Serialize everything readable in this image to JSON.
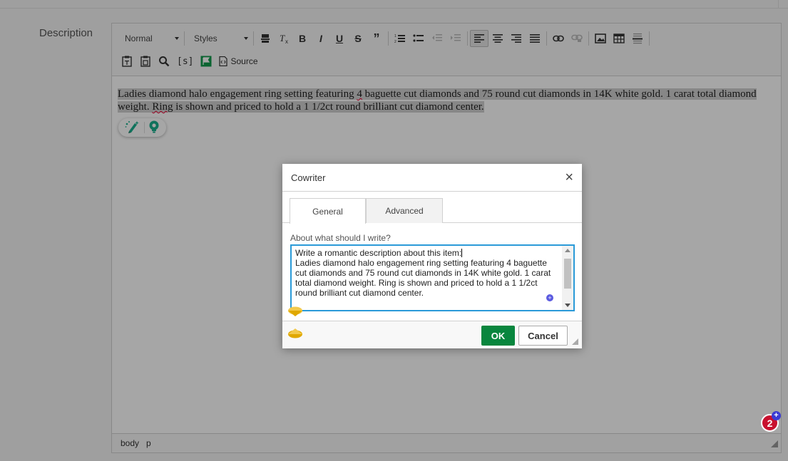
{
  "form": {
    "description_label": "Description"
  },
  "toolbar": {
    "format_combo": "Normal",
    "styles_combo": "Styles",
    "source_label": "Source",
    "variables_label": "[s]"
  },
  "editor": {
    "content_part1": "Ladies diamond halo engagement ring setting featuring ",
    "content_misspelled1": "4",
    "content_part2": " baguette cut diamonds and 75 round cut diamonds in 14K white gold. 1 carat total diamond weight. ",
    "content_misspelled2": "Ring",
    "content_part3": " is shown and priced to hold a 1 1/2ct round brilliant cut diamond center.",
    "path_body": "body",
    "path_p": "p"
  },
  "dialog": {
    "title": "Cowriter",
    "close_glyph": "×",
    "tabs": [
      {
        "label": "General",
        "active": true
      },
      {
        "label": "Advanced",
        "active": false
      }
    ],
    "prompt_label": "About what should I write?",
    "prompt_value_line1": "Write a romantic description about this item:",
    "prompt_value_body": "\nLadies diamond halo engagement ring setting featuring 4 baguette cut diamonds and 75 round cut diamonds in 14K white gold. 1 carat total diamond weight. Ring is shown and priced to hold a 1 1/2ct round brilliant cut diamond center.",
    "ok_label": "OK",
    "cancel_label": "Cancel"
  },
  "notification": {
    "count": "2",
    "plus": "+"
  },
  "colors": {
    "ok_green": "#09863e",
    "focus_blue": "#2a9ad8",
    "badge_red": "#c8102e",
    "ai_teal": "#19b08e"
  },
  "icons": [
    "paste-text-icon",
    "paste-word-icon",
    "find-icon",
    "special-char-icon",
    "flag-icon",
    "source-icon",
    "numbered-list-icon",
    "bullet-list-icon",
    "outdent-icon",
    "indent-icon",
    "align-left-icon",
    "align-center-icon",
    "align-right-icon",
    "justify-icon",
    "link-icon",
    "unlink-icon",
    "image-icon",
    "table-icon",
    "horizontal-rule-icon",
    "copy-format-icon",
    "remove-format-icon",
    "ai-magic-pen-icon",
    "lightbulb-icon",
    "gem-icon"
  ]
}
